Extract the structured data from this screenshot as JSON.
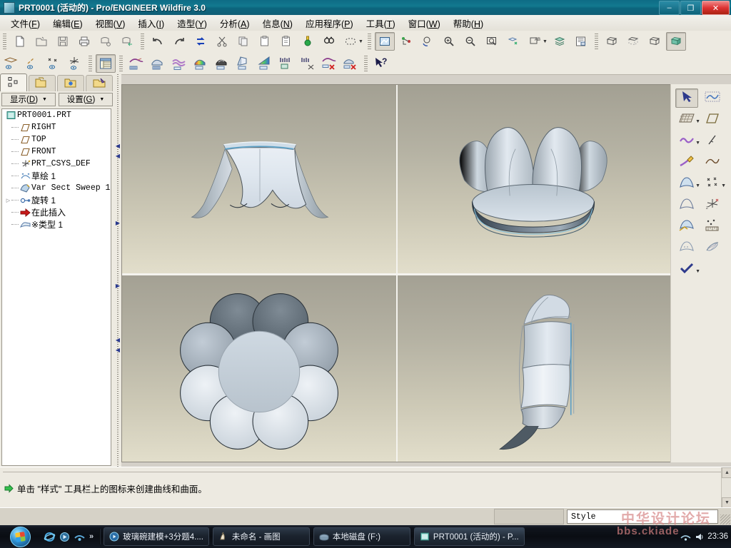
{
  "window": {
    "title": "PRT0001 (活动的) - Pro/ENGINEER Wildfire 3.0",
    "minimize_label": "–",
    "restore_label": "❐",
    "close_label": "✕"
  },
  "menubar": {
    "items": [
      {
        "label": "文件(F)",
        "name": "menu-file"
      },
      {
        "label": "编辑(E)",
        "name": "menu-edit"
      },
      {
        "label": "视图(V)",
        "name": "menu-view"
      },
      {
        "label": "插入(I)",
        "name": "menu-insert"
      },
      {
        "label": "造型(Y)",
        "name": "menu-style"
      },
      {
        "label": "分析(A)",
        "name": "menu-analysis"
      },
      {
        "label": "信息(N)",
        "name": "menu-info"
      },
      {
        "label": "应用程序(P)",
        "name": "menu-applications"
      },
      {
        "label": "工具(T)",
        "name": "menu-tools"
      },
      {
        "label": "窗口(W)",
        "name": "menu-window"
      },
      {
        "label": "帮助(H)",
        "name": "menu-help"
      }
    ]
  },
  "toolbar_top": {
    "groups": [
      [
        "new-file-icon",
        "open-file-icon",
        "save-icon",
        "print-icon",
        "send-mail-icon",
        "send-link-icon"
      ],
      [
        "undo-icon",
        "redo-icon",
        "regenerate-icon",
        "cut-icon",
        "copy-icon",
        "paste-icon",
        "paste-special-icon",
        "sensitivity-icon",
        "find-icon",
        "select-region-icon"
      ],
      [
        "repaint-icon",
        "spin-center-icon",
        "reorient-icon",
        "zoom-in-icon",
        "zoom-out-icon",
        "refit-icon",
        "datum-display-icon",
        "annotation-display-icon",
        "layers-icon",
        "saved-views-icon"
      ],
      [
        "wireframe-icon",
        "hidden-line-icon",
        "no-hidden-icon",
        "shading-icon"
      ]
    ]
  },
  "toolbar_second": {
    "groups": [
      [
        "datum-plane-display-icon",
        "datum-axis-display-icon",
        "datum-point-display-icon",
        "datum-csys-display-icon"
      ],
      [
        "model-tree-icon"
      ],
      [
        "style-curve-icon",
        "style-surface-icon",
        "style-blend-icon",
        "style-analysis-icon",
        "style-shadow-icon",
        "style-section-icon",
        "style-color-icon",
        "measure-icon",
        "measure-off-icon",
        "delete-curve-icon",
        "delete-surface-icon"
      ],
      [
        "help-pointer-icon"
      ]
    ]
  },
  "navigator": {
    "tabs": [
      {
        "name": "tab-model-tree",
        "icon": "model-tree-icon",
        "active": true
      },
      {
        "name": "tab-folder-browser",
        "icon": "folder-browser-icon",
        "active": false
      },
      {
        "name": "tab-favorites",
        "icon": "favorites-folder-icon",
        "active": false
      },
      {
        "name": "tab-connections",
        "icon": "connections-folder-icon",
        "active": false
      }
    ],
    "buttons": [
      {
        "label": "显示(D)",
        "name": "show-dropdown-button",
        "caret": "▼"
      },
      {
        "label": "设置(G)",
        "name": "settings-dropdown-button",
        "caret": "▼"
      }
    ],
    "tree": [
      {
        "label": "PRT0001.PRT",
        "icon": "part-icon",
        "indent": 0,
        "mono": true,
        "expander": ""
      },
      {
        "label": "RIGHT",
        "icon": "datum-plane-icon",
        "indent": 1,
        "mono": true,
        "expander": ""
      },
      {
        "label": "TOP",
        "icon": "datum-plane-icon",
        "indent": 1,
        "mono": true,
        "expander": ""
      },
      {
        "label": "FRONT",
        "icon": "datum-plane-icon",
        "indent": 1,
        "mono": true,
        "expander": ""
      },
      {
        "label": "PRT_CSYS_DEF",
        "icon": "datum-csys-icon",
        "indent": 1,
        "mono": true,
        "expander": ""
      },
      {
        "label": "草绘 1",
        "icon": "sketch-icon",
        "indent": 1,
        "mono": false,
        "expander": ""
      },
      {
        "label": "Var Sect Sweep 1",
        "icon": "sweep-icon",
        "indent": 1,
        "mono": true,
        "expander": ""
      },
      {
        "label": "旋转 1",
        "icon": "revolve-icon",
        "indent": 1,
        "mono": false,
        "expander": "▷"
      },
      {
        "label": "在此插入",
        "icon": "insert-here-icon",
        "indent": 1,
        "mono": false,
        "expander": ""
      },
      {
        "label": "※类型 1",
        "icon": "style-feature-icon",
        "indent": 1,
        "mono": false,
        "expander": ""
      }
    ]
  },
  "right_toolbar": {
    "buttons": [
      {
        "name": "select-arrow-tool",
        "icon": "arrow-select-icon",
        "pressed": true,
        "caret": false
      },
      {
        "name": "curve-tool",
        "icon": "style-curve-icon",
        "pressed": false,
        "caret": false
      },
      {
        "name": "grid-tool",
        "icon": "grid-icon",
        "pressed": false,
        "caret": true
      },
      {
        "name": "plane-tool",
        "icon": "plane-icon",
        "pressed": false,
        "caret": false
      },
      {
        "name": "curve-edit-tool",
        "icon": "curve-wave-icon",
        "pressed": false,
        "caret": true
      },
      {
        "name": "line-tool",
        "icon": "line-icon",
        "pressed": false,
        "caret": false
      },
      {
        "name": "curve-draw-tool",
        "icon": "pencil-curve-icon",
        "pressed": false,
        "caret": false
      },
      {
        "name": "spline-tool",
        "icon": "spline-icon",
        "pressed": false,
        "caret": false
      },
      {
        "name": "surface-tool",
        "icon": "surface-icon",
        "pressed": false,
        "caret": true
      },
      {
        "name": "point-tool",
        "icon": "points-icon",
        "pressed": false,
        "caret": true
      },
      {
        "name": "surface-trim-tool",
        "icon": "surface-plain-icon",
        "pressed": false,
        "caret": false
      },
      {
        "name": "csys-tool",
        "icon": "csys-icon",
        "pressed": false,
        "caret": false
      },
      {
        "name": "surface-connect-tool",
        "icon": "surface-connect-icon",
        "pressed": false,
        "caret": false
      },
      {
        "name": "measure-tool",
        "icon": "measure-ruler-icon",
        "pressed": false,
        "caret": false
      },
      {
        "name": "surface-analysis-tool",
        "icon": "surface-analysis-icon",
        "pressed": false,
        "caret": false
      },
      {
        "name": "curvature-tool",
        "icon": "curvature-icon",
        "pressed": false,
        "caret": false
      },
      {
        "name": "accept-tool",
        "icon": "checkmark-icon",
        "pressed": false,
        "caret": true
      }
    ]
  },
  "viewport": {
    "quadrants": [
      {
        "name": "viewport-front-view",
        "view": "front"
      },
      {
        "name": "viewport-trimetric-view",
        "view": "trimetric"
      },
      {
        "name": "viewport-top-view",
        "view": "top"
      },
      {
        "name": "viewport-right-view",
        "view": "right"
      }
    ],
    "model": {
      "petal_count": 8,
      "description": "玻璃碗 flower-shaped bowl"
    }
  },
  "status": {
    "message": "单击 \"样式\" 工具栏上的图标来创建曲线和曲面。",
    "arrow_icon": "green-arrow-icon",
    "combo_value": "Style",
    "combo_caret": "▼"
  },
  "taskbar": {
    "start_label": "",
    "quick_launch": [
      {
        "name": "ie-quicklaunch-icon",
        "icon": "internet-explorer-icon"
      },
      {
        "name": "app-quicklaunch-icon",
        "icon": "media-icon"
      },
      {
        "name": "net-quicklaunch-icon",
        "icon": "network-icon"
      }
    ],
    "overflow_label": "»",
    "tasks": [
      {
        "label": "玻璃碗建模+3分题4....",
        "icon": "media-player-icon",
        "active": false
      },
      {
        "label": "未命名 - 画图",
        "icon": "paint-icon",
        "active": false
      },
      {
        "label": "本地磁盘 (F:)",
        "icon": "folder-icon",
        "active": false
      },
      {
        "label": "PRT0001 (活动的) - P...",
        "icon": "proe-icon",
        "active": true
      }
    ],
    "clock": "23:36",
    "tray_icons": [
      "tray-network-icon",
      "tray-volume-icon"
    ]
  },
  "watermark": {
    "line1": "中华设计论坛",
    "line2": "bbs.ckiade"
  },
  "colors": {
    "titlebar": "#0e6b85",
    "toolbar_bg": "#edeae1",
    "viewport_top": "#a3a093",
    "viewport_bottom": "#e2decb",
    "accent_blue": "#2b3a8f"
  }
}
